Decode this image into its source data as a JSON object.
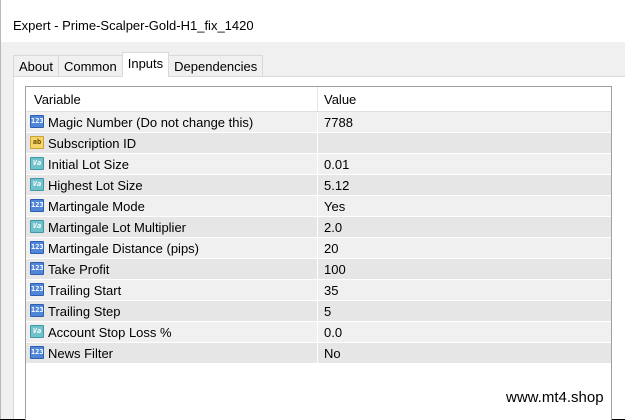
{
  "window": {
    "title": "Expert - Prime-Scalper-Gold-H1_fix_1420"
  },
  "tabs": [
    {
      "label": "About",
      "active": false
    },
    {
      "label": "Common",
      "active": false
    },
    {
      "label": "Inputs",
      "active": true
    },
    {
      "label": "Dependencies",
      "active": false
    }
  ],
  "table": {
    "headers": {
      "variable": "Variable",
      "value": "Value"
    },
    "rows": [
      {
        "icon": "int",
        "icon_text": "123",
        "name": "Magic Number (Do not change this)",
        "value": "7788"
      },
      {
        "icon": "str",
        "icon_text": "ab",
        "name": "Subscription ID",
        "value": ""
      },
      {
        "icon": "dbl",
        "icon_text": "Va",
        "name": "Initial Lot Size",
        "value": "0.01"
      },
      {
        "icon": "dbl",
        "icon_text": "Va",
        "name": "Highest Lot Size",
        "value": "5.12"
      },
      {
        "icon": "int",
        "icon_text": "123",
        "name": "Martingale Mode",
        "value": "Yes"
      },
      {
        "icon": "dbl",
        "icon_text": "Va",
        "name": "Martingale Lot Multiplier",
        "value": "2.0"
      },
      {
        "icon": "int",
        "icon_text": "123",
        "name": "Martingale Distance (pips)",
        "value": "20"
      },
      {
        "icon": "int",
        "icon_text": "123",
        "name": "Take Profit",
        "value": "100"
      },
      {
        "icon": "int",
        "icon_text": "123",
        "name": "Trailing Start",
        "value": "35"
      },
      {
        "icon": "int",
        "icon_text": "123",
        "name": "Trailing Step",
        "value": "5"
      },
      {
        "icon": "dbl",
        "icon_text": "Va",
        "name": "Account Stop Loss %",
        "value": "0.0"
      },
      {
        "icon": "int",
        "icon_text": "123",
        "name": "News Filter",
        "value": "No"
      }
    ]
  },
  "watermark": "www.mt4.shop",
  "colors": {
    "row_odd": "#f0f0f0",
    "row_even": "#e6e6e6",
    "int_icon": "#4f86d8",
    "string_icon": "#f5d46a",
    "double_icon": "#6fc2cc"
  }
}
